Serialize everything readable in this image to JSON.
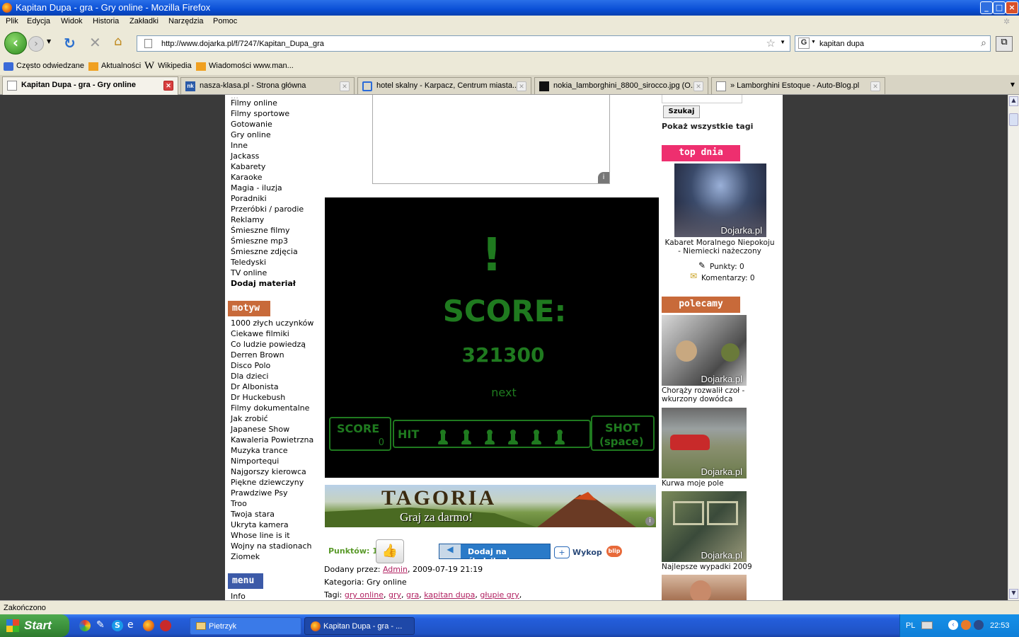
{
  "window": {
    "title": "Kapitan Dupa - gra - Gry online - Mozilla Firefox",
    "min": "_",
    "max": "□",
    "close": "×"
  },
  "menu": [
    "Plik",
    "Edycja",
    "Widok",
    "Historia",
    "Zakładki",
    "Narzędzia",
    "Pomoc"
  ],
  "nav": {
    "url": "http://www.dojarka.pl/f/7247/Kapitan_Dupa_gra",
    "search": "kapitan dupa",
    "search_engine": "G"
  },
  "bookmarks": [
    "Często odwiedzane",
    "Aktualności",
    "Wikipedia",
    "Wiadomości www.man..."
  ],
  "tabs": [
    {
      "label": "Kapitan Dupa - gra - Gry online",
      "active": true
    },
    {
      "label": "nasza-klasa.pl - Strona główna",
      "active": false
    },
    {
      "label": "hotel skalny - Karpacz, Centrum miasta...",
      "active": false
    },
    {
      "label": "nokia_lamborghini_8800_sirocco.jpg (O...",
      "active": false
    },
    {
      "label": "» Lamborghini Estoque - Auto-Blog.pl",
      "active": false
    }
  ],
  "left": {
    "categories": [
      "Filmy online",
      "Filmy sportowe",
      "Gotowanie",
      "Gry online",
      "Inne",
      "Jackass",
      "Kabarety",
      "Karaoke",
      "Magia - iluzja",
      "Poradniki",
      "Przeróbki / parodie",
      "Reklamy",
      "Śmieszne filmy",
      "Śmieszne mp3",
      "Śmieszne zdjęcia",
      "Teledyski",
      "TV online"
    ],
    "add_material": "Dodaj materiał",
    "motyw_head": "motyw",
    "motyw": [
      "1000 złych uczynków",
      "Ciekawe filmiki",
      "Co ludzie powiedzą",
      "Derren Brown",
      "Disco Polo",
      "Dla dzieci",
      "Dr Albonista",
      "Dr Huckebush",
      "Filmy dokumentalne",
      "Jak zrobić",
      "Japanese Show",
      "Kawaleria Powietrzna",
      "Muzyka trance",
      "Nimportequi",
      "Najgorszy kierowca",
      "Piękne dziewczyny",
      "Prawdziwe Psy",
      "Troo",
      "Twoja stara",
      "Ukryta kamera",
      "Whose line is it",
      "Wojny na stadionach",
      "Ziomek"
    ],
    "menu_head": "menu",
    "menu_first": "Info"
  },
  "game": {
    "exclaim": "!",
    "score_label": "SCORE:",
    "score_value": "321300",
    "next": "next",
    "hud_score": "SCORE",
    "hud_score_val": "0",
    "hud_hit": "HIT",
    "hud_shot": "SHOT",
    "hud_space": "(space)"
  },
  "banner": {
    "title": "TAGORIA",
    "subtitle": "Graj za darmo!"
  },
  "meta": {
    "points_label": "Punktów: 1",
    "sledzik": "Dodaj na śledzik.pl",
    "wykop": "Wykop",
    "added_by_label": "Dodany przez:",
    "added_by": "Admin",
    "date": ", 2009-07-19 21:19",
    "category": "Kategoria: Gry online",
    "tags_label": "Tagi:",
    "tags": [
      "gry online",
      "gry",
      "gra",
      "kapitan dupa",
      "głupie gry"
    ]
  },
  "right": {
    "search_btn": "Szukaj",
    "show_tags": "Pokaż wszystkie tagi",
    "top_head": "top dnia",
    "top_caption": "Kabaret Moralnego Niepokoju - Niemiecki nażeczony",
    "top_points": "Punkty: 0",
    "top_comments": "Komentarzy: 0",
    "watermark": "Dojarka.pl",
    "polecamy_head": "polecamy",
    "rec": [
      "Chorąży rozwalił czoł - wkurzony dowódca",
      "Kurwa moje pole",
      "Najlepsze wypadki 2009"
    ]
  },
  "status": "Zakończono",
  "taskbar": {
    "start": "Start",
    "items": [
      "Pietrzyk",
      "Kapitan Dupa - gra - ..."
    ],
    "lang": "PL",
    "clock": "22:53"
  },
  "colors": {
    "accent_pink": "#ee2f6f",
    "accent_brown": "#c86a3a",
    "menu_blue": "#3c5aa8",
    "game_green": "#1f7a1f"
  }
}
